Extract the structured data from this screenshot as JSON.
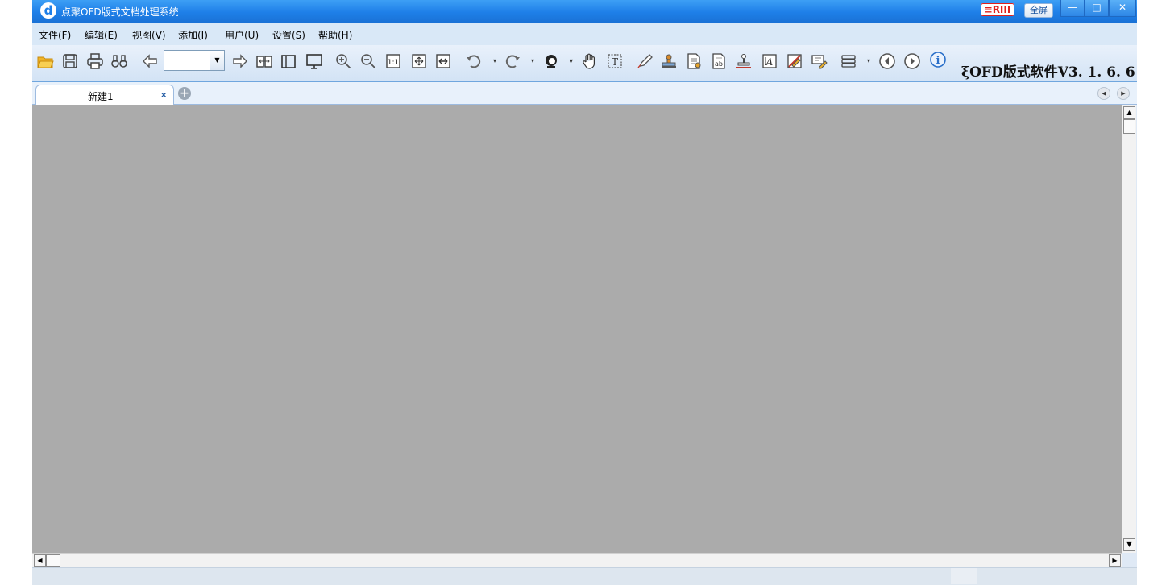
{
  "window": {
    "title": "点聚OFD版式文档处理系统",
    "logo_text": "d",
    "brand_logo": "≡RIII",
    "fullscreen_label": "全屏",
    "min_glyph": "—",
    "max_glyph": "□",
    "close_glyph": "✕"
  },
  "menu": {
    "items": [
      {
        "label": "文件(F)"
      },
      {
        "label": "编辑(E)"
      },
      {
        "label": "视图(V)"
      },
      {
        "label": "添加(I)"
      },
      {
        "label": "用户(U)"
      },
      {
        "label": "设置(S)"
      },
      {
        "label": "帮助(H)"
      }
    ]
  },
  "toolbar": {
    "page_input_value": "",
    "version_label": "ξOFD版式软件V3. 1. 6. 6",
    "icons": [
      "open-folder-icon",
      "save-icon",
      "print-icon",
      "find-icon",
      "prev-page-icon",
      "next-page-icon",
      "two-page-icon",
      "single-page-icon",
      "fullscreen-view-icon",
      "zoom-in-icon",
      "zoom-out-icon",
      "actual-size-icon",
      "fit-page-icon",
      "fit-width-icon",
      "rotate-left-icon",
      "rotate-right-icon",
      "user-icon",
      "hand-tool-icon",
      "text-select-icon",
      "handwrite-icon",
      "stamp-icon",
      "insert-doc-icon",
      "text-box-icon",
      "seal-icon",
      "text-annotation-icon",
      "erase-icon",
      "edit-note-icon",
      "menu-list-icon",
      "back-icon",
      "forward-icon",
      "info-icon"
    ]
  },
  "tabs": {
    "items": [
      {
        "label": "新建1",
        "close_glyph": "×"
      }
    ],
    "add_glyph": "+",
    "prev_glyph": "◀",
    "next_glyph": "▶"
  },
  "scrollbars": {
    "up_glyph": "▲",
    "down_glyph": "▼",
    "left_glyph": "◀",
    "right_glyph": "▶"
  }
}
